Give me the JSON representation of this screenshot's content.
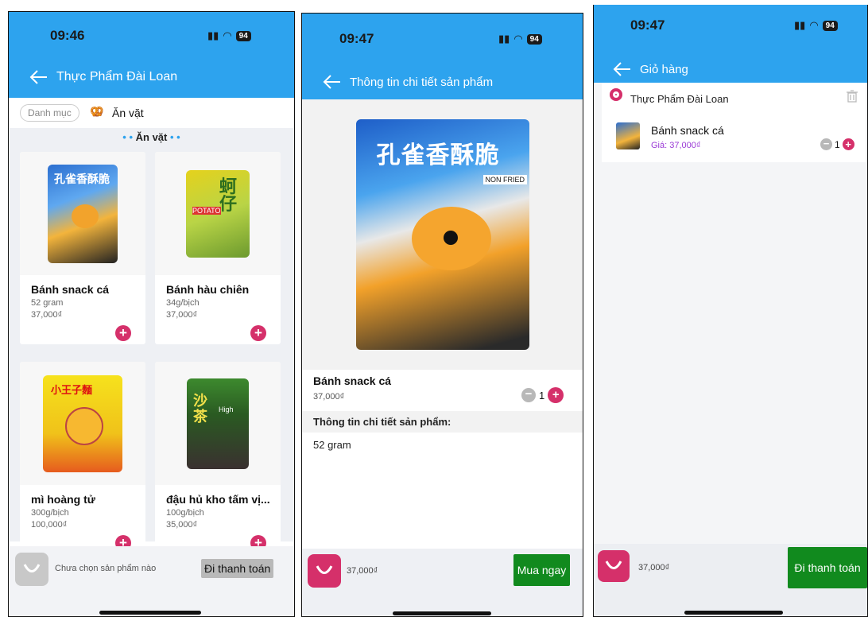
{
  "status": {
    "screen1_time": "09:46",
    "screen2_time": "09:47",
    "screen3_time": "09:47",
    "battery": "94"
  },
  "screen1": {
    "title": "Thực Phẩm Đài Loan",
    "category_button": "Danh mục",
    "current_category": "Ăn vặt",
    "section_title": "Ăn vặt",
    "products": [
      {
        "name": "Bánh snack cá",
        "weight": "52 gram",
        "price": "37,000₫"
      },
      {
        "name": "Bánh hàu chiên",
        "weight": "34g/bịch",
        "price": "37,000₫"
      },
      {
        "name": "mì hoàng tử",
        "weight": "300g/bịch",
        "price": "100,000₫"
      },
      {
        "name": "đậu hủ kho tấm vị...",
        "weight": "100g/bịch",
        "price": "35,000₫"
      }
    ],
    "cart_empty_text": "Chưa chọn sản phẩm nào",
    "checkout_button": "Đi thanh toán"
  },
  "screen2": {
    "title": "Thông tin chi tiết sản phẩm",
    "product_name": "Bánh snack cá",
    "product_price": "37,000₫",
    "quantity": "1",
    "details_heading": "Thông tin chi tiết sản phẩm:",
    "details_text": "52 gram",
    "cart_total": "37,000₫",
    "buy_button": "Mua ngay"
  },
  "screen3": {
    "title": "Giỏ hàng",
    "store_name": "Thực Phẩm Đài Loan",
    "item_name": "Bánh snack cá",
    "item_price": "Giá: 37,000₫",
    "quantity": "1",
    "cart_total": "37,000₫",
    "checkout_button": "Đi thanh toán"
  },
  "colors": {
    "header_blue": "#2da3ee",
    "accent_pink": "#d5306a",
    "buy_green": "#118a1e",
    "price_purple": "#9b3bd6"
  }
}
